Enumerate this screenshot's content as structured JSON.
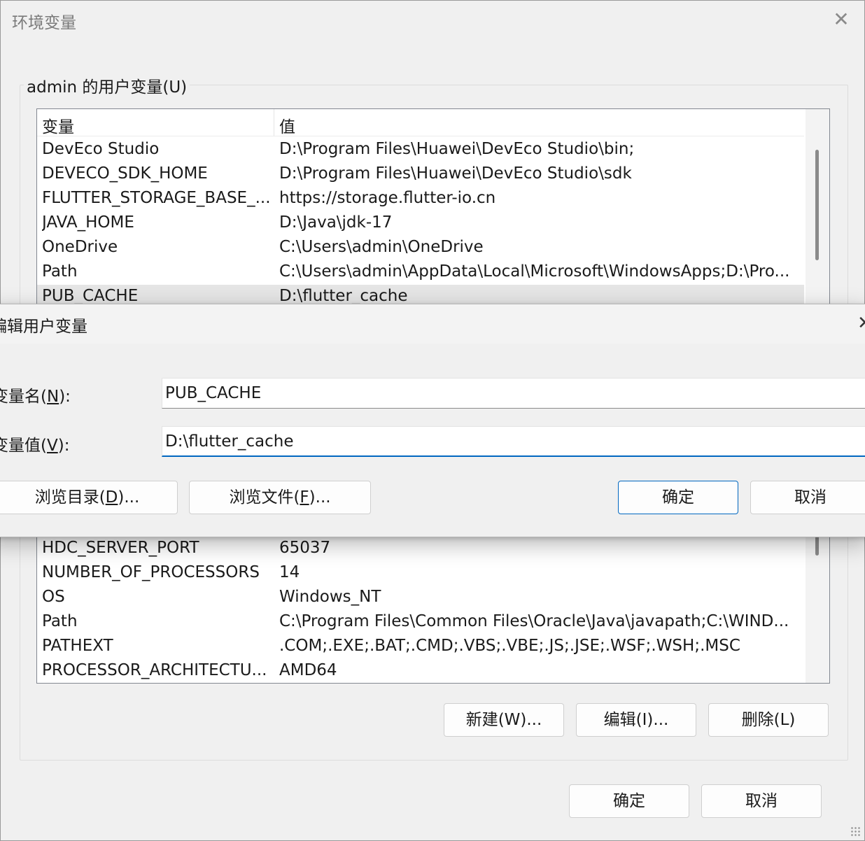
{
  "env_dialog": {
    "title": "环境变量",
    "close_glyph": "✕",
    "user_group_label": "admin 的用户变量(U)",
    "columns": {
      "name": "变量",
      "value": "值"
    },
    "user_rows": [
      {
        "name": "DevEco Studio",
        "value": "D:\\Program Files\\Huawei\\DevEco Studio\\bin;"
      },
      {
        "name": "DEVECO_SDK_HOME",
        "value": "D:\\Program Files\\Huawei\\DevEco Studio\\sdk"
      },
      {
        "name": "FLUTTER_STORAGE_BASE_...",
        "value": "https://storage.flutter-io.cn"
      },
      {
        "name": "JAVA_HOME",
        "value": "D:\\Java\\jdk-17"
      },
      {
        "name": "OneDrive",
        "value": "C:\\Users\\admin\\OneDrive"
      },
      {
        "name": "Path",
        "value": "C:\\Users\\admin\\AppData\\Local\\Microsoft\\WindowsApps;D:\\Pro..."
      },
      {
        "name": "PUB_CACHE",
        "value": "D:\\flutter_cache",
        "selected": true
      }
    ],
    "system_rows": [
      {
        "name": "HDC_SERVER_PORT",
        "value": "65037"
      },
      {
        "name": "NUMBER_OF_PROCESSORS",
        "value": "14"
      },
      {
        "name": "OS",
        "value": "Windows_NT"
      },
      {
        "name": "Path",
        "value": "C:\\Program Files\\Common Files\\Oracle\\Java\\javapath;C:\\WIND..."
      },
      {
        "name": "PATHEXT",
        "value": ".COM;.EXE;.BAT;.CMD;.VBS;.VBE;.JS;.JSE;.WSF;.WSH;.MSC"
      },
      {
        "name": "PROCESSOR_ARCHITECTU...",
        "value": "AMD64"
      }
    ],
    "buttons": {
      "new": "新建(W)...",
      "edit": "编辑(I)...",
      "delete": "删除(L)"
    },
    "footer": {
      "ok": "确定",
      "cancel": "取消"
    }
  },
  "edit_dialog": {
    "title": "编辑用户变量",
    "close_glyph": "✕",
    "name_label": {
      "pre": "变量名(",
      "key": "N",
      "post": "):"
    },
    "value_label": {
      "pre": "变量值(",
      "key": "V",
      "post": "):"
    },
    "name_value": "PUB_CACHE",
    "value_value": "D:\\flutter_cache",
    "browse_dir": {
      "pre": "浏览目录(",
      "key": "D",
      "post": ")..."
    },
    "browse_file": {
      "pre": "浏览文件(",
      "key": "F",
      "post": ")..."
    },
    "ok": "确定",
    "cancel": "取消"
  },
  "colors": {
    "accent": "#0067c0",
    "selection": "#e5e5e5",
    "dialog_bg": "#f0f0f0"
  }
}
